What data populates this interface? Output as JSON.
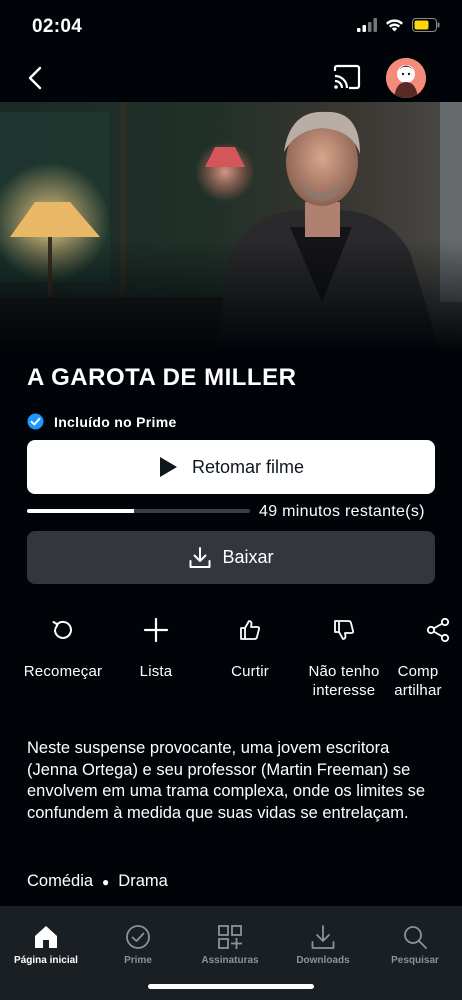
{
  "status": {
    "time": "02:04"
  },
  "movie": {
    "title": "A GAROTA DE MILLER",
    "prime_label": "Incluído no Prime",
    "resume_label": "Retomar filme",
    "progress": 0.48,
    "remaining": "49 minutos restante(s)",
    "download_label": "Baixar",
    "synopsis": "Neste suspense provocante, uma jovem escritora (Jenna Ortega) e seu professor (Martin Freeman) se envolvem em uma trama complexa, onde os limites se confundem à medida que suas vidas se entrelaçam.",
    "genres": [
      "Comédia",
      "Drama"
    ]
  },
  "actions": [
    {
      "label": "Recomeçar",
      "icon": "restart-icon"
    },
    {
      "label": "Lista",
      "icon": "plus-icon"
    },
    {
      "label": "Curtir",
      "icon": "thumbs-up-icon"
    },
    {
      "label": "Não tenho interesse",
      "icon": "thumbs-down-icon"
    },
    {
      "label": "Compartilhar",
      "icon": "share-icon"
    }
  ],
  "bottom_nav": [
    {
      "label": "Página inicial",
      "icon": "home-icon",
      "active": true
    },
    {
      "label": "Prime",
      "icon": "check-circle-icon"
    },
    {
      "label": "Assinaturas",
      "icon": "grid-plus-icon"
    },
    {
      "label": "Downloads",
      "icon": "download-icon"
    },
    {
      "label": "Pesquisar",
      "icon": "search-icon"
    }
  ],
  "colors": {
    "background": "#000408",
    "accent": "#1a98ff",
    "nav_bg": "#1a1f24"
  }
}
